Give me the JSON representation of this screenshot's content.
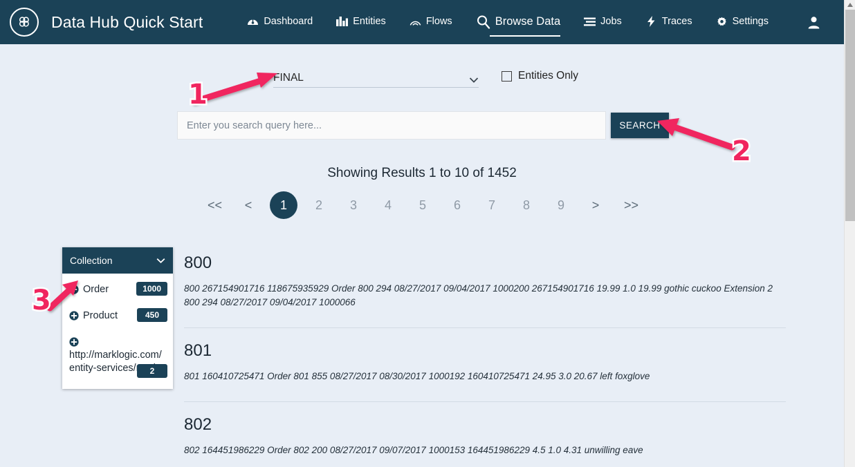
{
  "app": {
    "brand_title": "Data Hub Quick Start",
    "logo_icon": "marklogic-logo-icon",
    "nav_items": [
      {
        "label": "Dashboard",
        "icon": "dashboard-icon",
        "active": false
      },
      {
        "label": "Entities",
        "icon": "entities-icon",
        "active": false
      },
      {
        "label": "Flows",
        "icon": "flows-icon",
        "active": false
      },
      {
        "label": "Browse Data",
        "icon": "search-icon",
        "active": true
      },
      {
        "label": "Jobs",
        "icon": "jobs-icon",
        "active": false
      },
      {
        "label": "Traces",
        "icon": "traces-bolt-icon",
        "active": false
      },
      {
        "label": "Settings",
        "icon": "gear-icon",
        "active": false
      }
    ],
    "avatar_icon": "user-avatar-icon"
  },
  "colors": {
    "navbar": "#1b4257",
    "page_background": "#e8eef6",
    "accent_annotation": "#f0255f",
    "badge": "#1b4257"
  },
  "search": {
    "database_selected": "FINAL",
    "database_chevron_icon": "chevron-down-icon",
    "entities_only_label": "Entities Only",
    "entities_only_checked": false,
    "query_value": "",
    "query_placeholder": "Enter you search query here...",
    "search_button_label": "SEARCH"
  },
  "results_meta": {
    "showing_text": "Showing Results 1 to 10 of 1452",
    "from": 1,
    "to": 10,
    "total": 1452
  },
  "pagination": {
    "first_label": "<<",
    "prev_label": "<",
    "pages": [
      "1",
      "2",
      "3",
      "4",
      "5",
      "6",
      "7",
      "8",
      "9"
    ],
    "current_page": "1",
    "next_label": ">",
    "last_label": ">>"
  },
  "facet": {
    "title": "Collection",
    "collapse_icon": "chevron-down-icon",
    "items": [
      {
        "label": "Order",
        "count": "1000",
        "add_icon": "plus-circle-icon"
      },
      {
        "label": "Product",
        "count": "450",
        "add_icon": "plus-circle-icon"
      },
      {
        "label": "http://marklogic.com/entity-services/mod..",
        "count": "2",
        "add_icon": "plus-circle-icon"
      }
    ]
  },
  "results": [
    {
      "title": "800",
      "snippet": "800 267154901716 118675935929 Order 800 294 08/27/2017 09/04/2017 1000200 267154901716 19.99 1.0 19.99 gothic cuckoo Extension 2 800 294 08/27/2017 09/04/2017 1000066"
    },
    {
      "title": "801",
      "snippet": "801 160410725471 Order 801 855 08/27/2017 08/30/2017 1000192 160410725471 24.95 3.0 20.67 left foxglove"
    },
    {
      "title": "802",
      "snippet": "802 164451986229 Order 802 200 08/27/2017 09/07/2017 1000153 164451986229 4.5 1.0 4.31 unwilling eave"
    }
  ],
  "annotations": [
    {
      "label": "1",
      "target": "database-select"
    },
    {
      "label": "2",
      "target": "search-button"
    },
    {
      "label": "3",
      "target": "facet-order-plus-icon"
    }
  ],
  "scrollbar": {
    "up_arrow_icon": "caret-up-icon"
  }
}
